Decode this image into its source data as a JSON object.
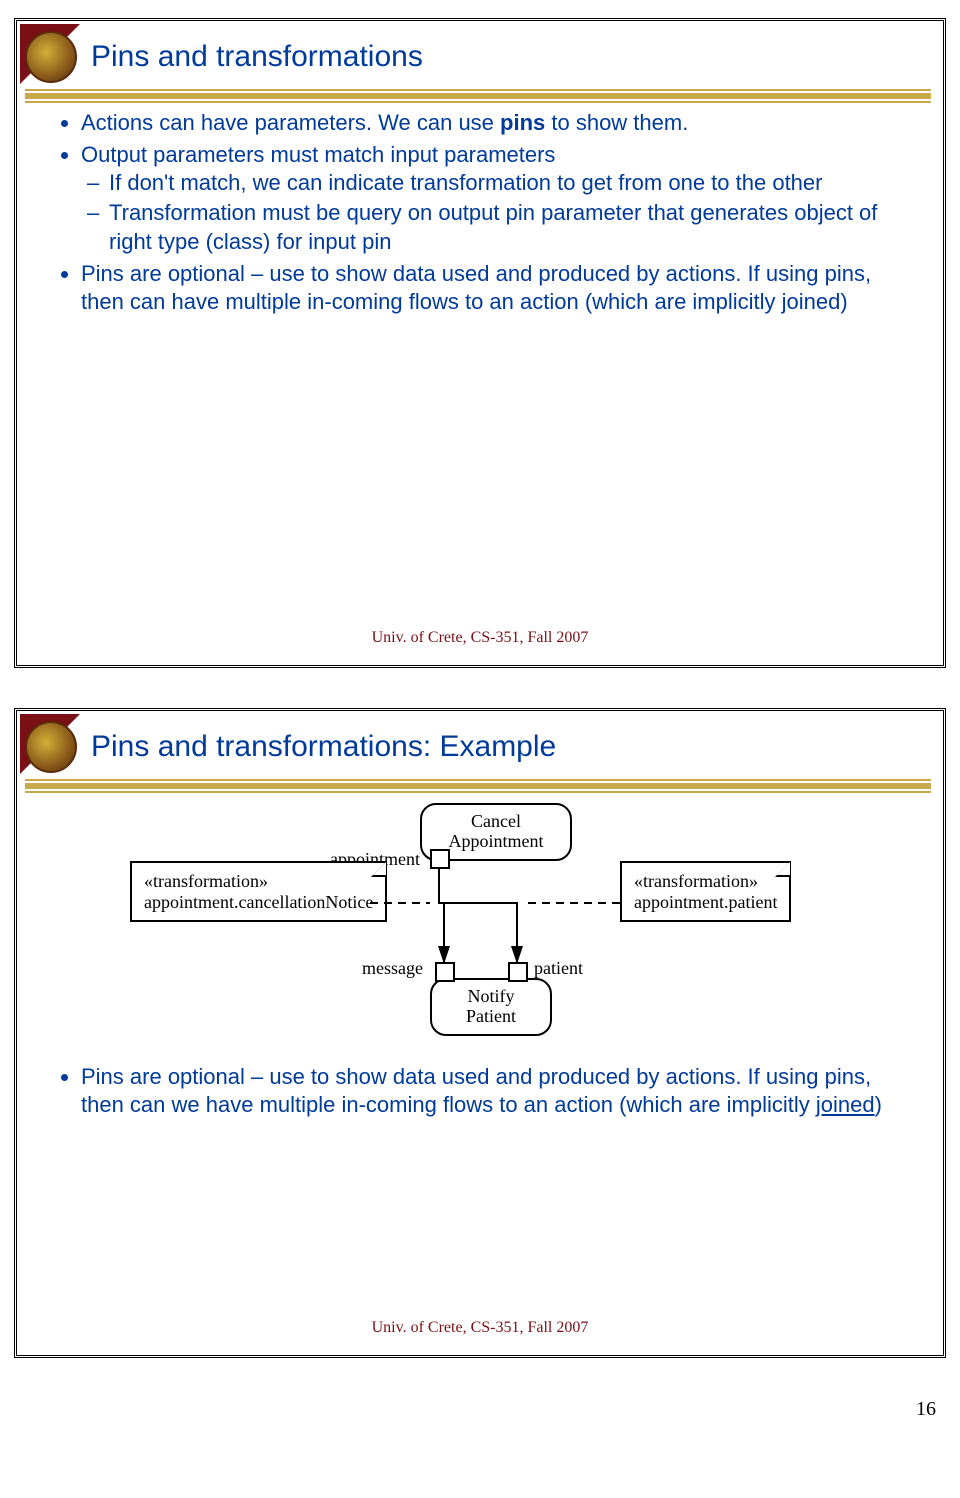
{
  "page_number": "16",
  "slide1": {
    "title": "Pins and transformations",
    "b1": "Actions can have parameters. We can use ",
    "b1_bold": "pins",
    "b1_tail": " to show them.",
    "b2": "Output parameters must match input parameters",
    "b2a": "If don't match, we can indicate transformation to get from one to the other",
    "b2b": "Transformation must be query on output pin parameter that generates object of right type (class) for input pin",
    "b3": "Pins are optional – use to show data used and produced by actions. If using pins, then can have multiple in-coming flows to an action (which are implicitly joined)",
    "footer": "Univ. of Crete, CS-351, Fall 2007"
  },
  "slide2": {
    "title": "Pins and transformations: Example",
    "action_cancel_l1": "Cancel",
    "action_cancel_l2": "Appointment",
    "action_notify_l1": "Notify",
    "action_notify_l2": "Patient",
    "pin_appointment": "appointment",
    "pin_message": "message",
    "pin_patient": "patient",
    "note_left_l1": "«transformation»",
    "note_left_l2": "appointment.cancellationNotice",
    "note_right_l1": "«transformation»",
    "note_right_l2": "appointment.patient",
    "b1": "Pins are optional – use to show data used and produced by actions. If using pins, then can we have multiple in-coming flows to an action (which are implicitly ",
    "b1_u": "joined",
    "b1_tail": ")",
    "footer": "Univ. of Crete, CS-351, Fall 2007"
  }
}
